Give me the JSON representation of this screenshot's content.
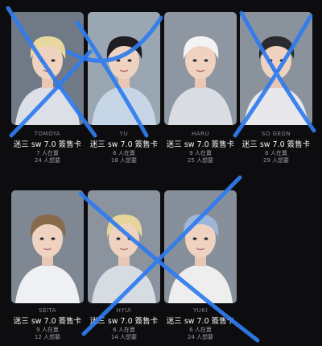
{
  "cards": [
    {
      "member": "TOMOYA",
      "title": "迷三 sw 7.0 簽售卡",
      "have": "7 人在賣",
      "want": "24 人想要",
      "crossed": true,
      "hair": "#e9d7a0",
      "outfit": "#dcdfe6",
      "bg": "#6f7a86"
    },
    {
      "member": "YU",
      "title": "迷三 sw 7.0 簽售卡",
      "have": "6 人在賣",
      "want": "18 人想要",
      "crossed": true,
      "hair": "#1d1d22",
      "outfit": "#c7d6e6",
      "bg": "#9aa7b3"
    },
    {
      "member": "HARU",
      "title": "迷三 sw 7.0 簽售卡",
      "have": "9 人在賣",
      "want": "25 人想要",
      "crossed": false,
      "hair": "#f3f3f3",
      "outfit": "#d9dde3",
      "bg": "#8e97a1"
    },
    {
      "member": "SO GEON",
      "title": "迷三 sw 7.0 簽售卡",
      "have": "6 人在賣",
      "want": "29 人想要",
      "crossed": true,
      "hair": "#2a2a30",
      "outfit": "#e8e8ec",
      "bg": "#8a939c"
    },
    {
      "member": "SEITA",
      "title": "迷三 sw 7.0 簽售卡",
      "have": "9 人在賣",
      "want": "12 人想要",
      "crossed": false,
      "hair": "#8a6a4c",
      "outfit": "#eef0f3",
      "bg": "#7f8892"
    },
    {
      "member": "HYUI",
      "title": "迷三 sw 7.0 簽售卡",
      "have": "6 人在賣",
      "want": "14 人想要",
      "crossed": true,
      "hair": "#e6d49a",
      "outfit": "#d7dbe2",
      "bg": "#8b949e"
    },
    {
      "member": "YUKI",
      "title": "迷三 sw 7.0 簽售卡",
      "have": "6 人在賣",
      "want": "24 人想要",
      "crossed": true,
      "hair": "#9fb6d8",
      "outfit": "#eeeeee",
      "bg": "#87909a"
    }
  ],
  "colors": {
    "background": "#0d0d0f",
    "cross_mark": "#2f7cf0"
  }
}
